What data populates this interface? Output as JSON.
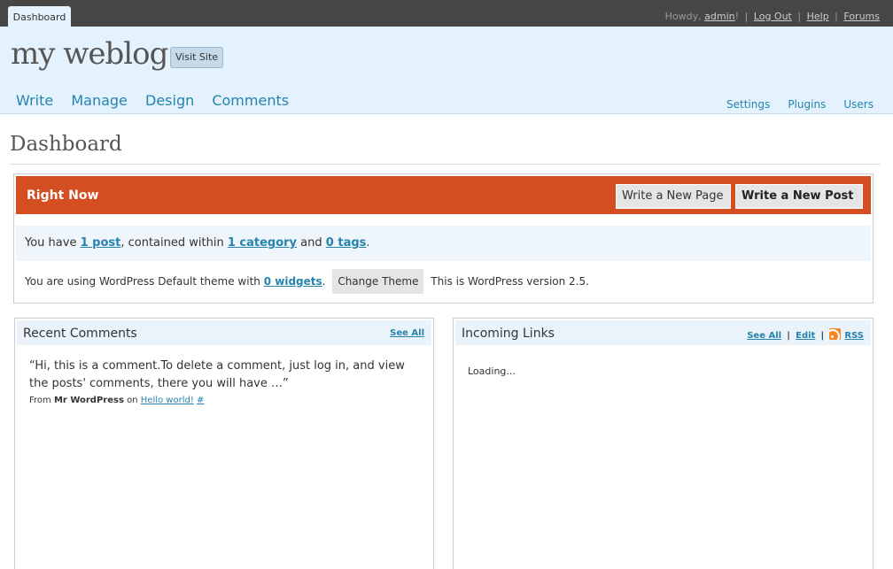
{
  "topbar": {
    "tab": "Dashboard",
    "howdy": "Howdy,",
    "user": "admin",
    "user_suffix": "!",
    "logout": "Log Out",
    "help": "Help",
    "forums": "Forums"
  },
  "header": {
    "blog_title": "my weblog",
    "visit_site": "Visit Site",
    "main_nav": [
      "Write",
      "Manage",
      "Design",
      "Comments"
    ],
    "sub_nav": [
      "Settings",
      "Plugins",
      "Users"
    ]
  },
  "page": {
    "title": "Dashboard"
  },
  "right_now": {
    "title": "Right Now",
    "write_page": "Write a New Page",
    "write_post": "Write a New Post",
    "you_have": "You have",
    "posts": "1 post",
    "contained": ", contained within",
    "categories": "1 category",
    "and": "and",
    "tags": "0 tags",
    "period": ".",
    "theme_text": "You are using WordPress Default theme with",
    "widgets": "0 widgets",
    "change_theme": "Change Theme",
    "version": "This is WordPress version 2.5."
  },
  "recent_comments": {
    "title": "Recent Comments",
    "see_all": "See All",
    "comment_text": "“Hi, this is a comment.To delete a comment, just log in, and view the posts' comments, there you will have …”",
    "from": "From",
    "author": "Mr WordPress",
    "on": "on",
    "post_link": "Hello world!",
    "permalink": "#"
  },
  "incoming_links": {
    "title": "Incoming Links",
    "see_all": "See All",
    "edit": "Edit",
    "rss": "RSS",
    "status": "Loading..."
  },
  "colors": {
    "topbar": "#464646",
    "header_bg": "#e4f2fd",
    "accent": "#d54e21",
    "link": "#2583ad"
  },
  "icons": {
    "feed": "rss-icon"
  }
}
